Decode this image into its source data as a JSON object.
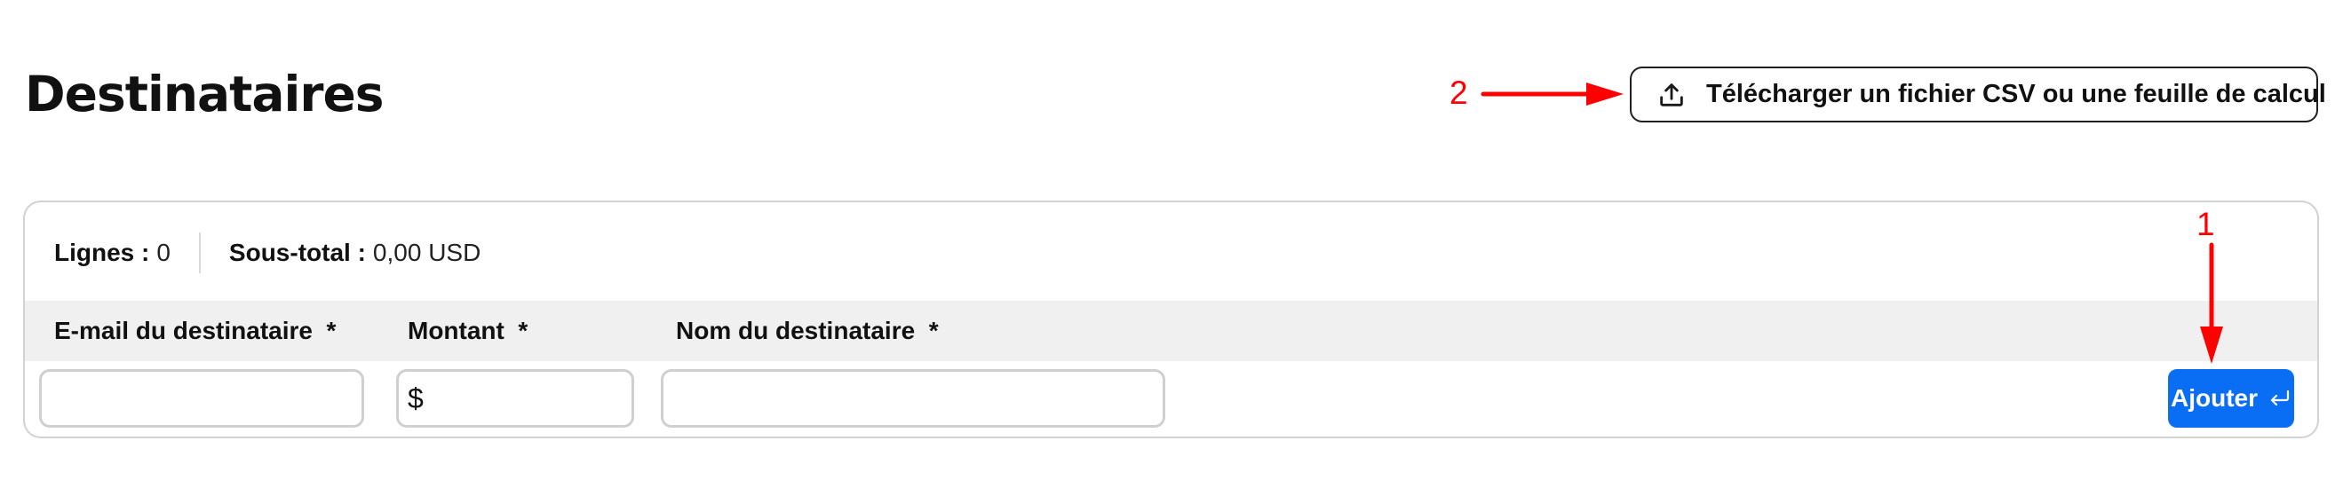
{
  "page": {
    "title": "Destinataires"
  },
  "toolbar": {
    "upload_label": "Télécharger un fichier CSV ou une feuille de calcul",
    "upload_icon": "upload-icon"
  },
  "summary": {
    "rows_label": "Lignes :",
    "rows_value": "0",
    "subtotal_label": "Sous-total :",
    "subtotal_value": "0,00 USD"
  },
  "columns": [
    {
      "label": "E-mail du destinataire  *"
    },
    {
      "label": "Montant  *"
    },
    {
      "label": "Nom du destinataire  *"
    }
  ],
  "form": {
    "email_value": "",
    "amount_currency_symbol": "$",
    "amount_value": "",
    "name_value": "",
    "add_label": "Ajouter",
    "add_icon": "enter-icon"
  },
  "annotations": [
    {
      "number": "1",
      "color": "#ff0000"
    },
    {
      "number": "2",
      "color": "#ff0000"
    }
  ],
  "colors": {
    "primary": "#0a6ef5",
    "annotation": "#ff0000",
    "header_bg": "#f0f0f0",
    "border": "#d2d2d2"
  }
}
